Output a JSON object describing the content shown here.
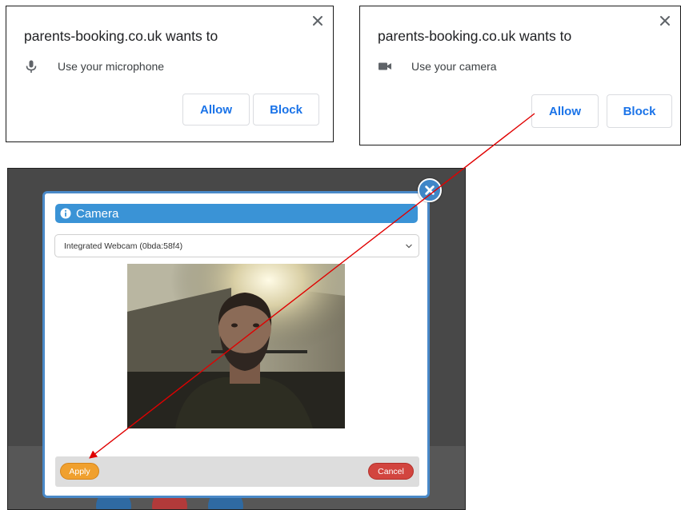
{
  "mic_prompt": {
    "title": "parents-booking.co.uk wants to",
    "permission": "Use your microphone",
    "allow_label": "Allow",
    "block_label": "Block",
    "icon": "microphone-icon"
  },
  "cam_prompt": {
    "title": "parents-booking.co.uk wants to",
    "permission": "Use your camera",
    "allow_label": "Allow",
    "block_label": "Block",
    "icon": "video-camera-icon"
  },
  "dialog": {
    "title": "Camera",
    "camera_select": {
      "value": "Integrated Webcam (0bda:58f4)"
    },
    "apply_label": "Apply",
    "cancel_label": "Cancel"
  },
  "colors": {
    "link_blue": "#1a73e8",
    "header_blue": "#3a93d6",
    "apply_orange": "#f0a02e",
    "cancel_red": "#d2453f",
    "arrow_red": "#e00000"
  }
}
